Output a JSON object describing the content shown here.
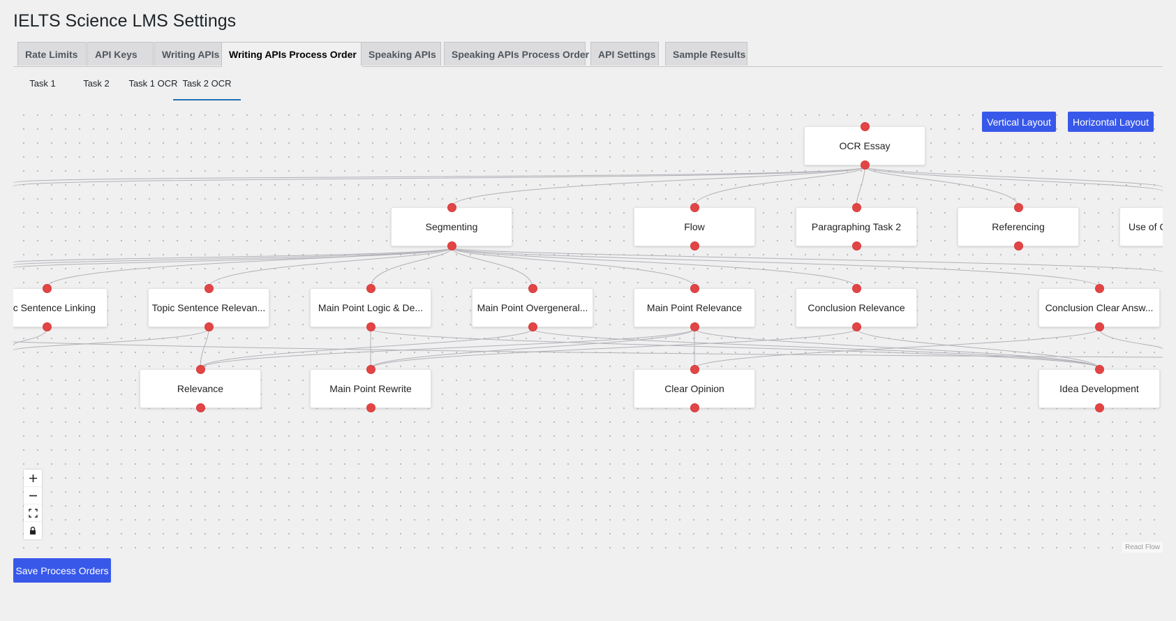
{
  "page": {
    "title": "IELTS Science LMS Settings"
  },
  "nav_tabs": [
    {
      "label": "Rate Limits",
      "active": false
    },
    {
      "label": "API Keys",
      "active": false
    },
    {
      "label": "Writing APIs",
      "active": false
    },
    {
      "label": "Writing APIs Process Order",
      "active": true
    },
    {
      "label": "Speaking APIs",
      "active": false
    },
    {
      "label": "Speaking APIs Process Order",
      "active": false
    },
    {
      "label": "API Settings",
      "active": false
    },
    {
      "label": "Sample Results",
      "active": false
    }
  ],
  "sub_tabs": [
    {
      "label": "Task 1",
      "active": false
    },
    {
      "label": "Task 2",
      "active": false
    },
    {
      "label": "Task 1 OCR",
      "active": false
    },
    {
      "label": "Task 2 OCR",
      "active": true
    }
  ],
  "layout_buttons": {
    "vertical": "Vertical Layout",
    "horizontal": "Horizontal Layout"
  },
  "flow": {
    "nodes": {
      "ocr_essay": "OCR Essay",
      "segmenting": "Segmenting",
      "flow": "Flow",
      "paragraphing_task_2": "Paragraphing Task 2",
      "referencing": "Referencing",
      "use_of": "Use of C",
      "topic_sentence_linking": "ic Sentence Linking",
      "topic_sentence_relevance": "Topic Sentence Relevan...",
      "main_point_logic": "Main Point Logic & De...",
      "main_point_overgeneral": "Main Point Overgeneral...",
      "main_point_relevance": "Main Point Relevance",
      "conclusion_relevance": "Conclusion Relevance",
      "conclusion_clear_answer": "Conclusion Clear Answ...",
      "relevance": "Relevance",
      "main_point_rewrite": "Main Point Rewrite",
      "clear_opinion": "Clear Opinion",
      "idea_development": "Idea Development"
    },
    "controls": {
      "zoom_in_icon": "plus-icon",
      "zoom_out_icon": "minus-icon",
      "fit_view_icon": "fit-view-icon",
      "lock_icon": "lock-icon"
    },
    "attribution": "React Flow",
    "colors": {
      "handle": "#e24545",
      "edge": "#b1b1b7",
      "button": "#3858e9"
    }
  },
  "save_button": "Save Process Orders"
}
